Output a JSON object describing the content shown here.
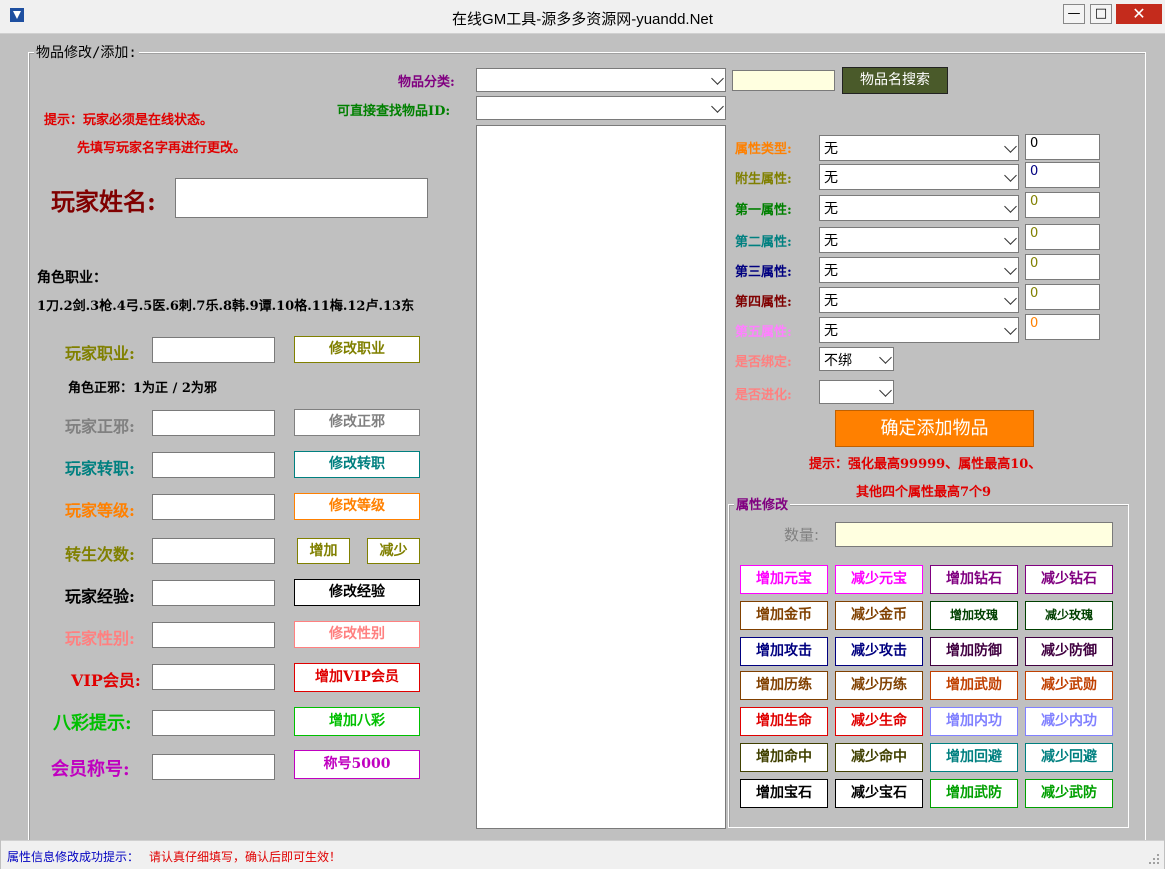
{
  "window": {
    "title": "在线GM工具-源多多资源网-yuandd.Net"
  },
  "group_main": {
    "title": "物品修改/添加:"
  },
  "tips": {
    "line1": "提示：玩家必须是在线状态。",
    "line2": "先填写玩家名字再进行更改。"
  },
  "player_name": {
    "label": "玩家姓名:",
    "value": ""
  },
  "job_info": {
    "title": "角色职业：",
    "list": "1刀.2剑.3枪.4弓.5医.6刺.7乐.8韩.9谭.10格.11梅.12卢.13东"
  },
  "zhengxie_info": "角色正邪：1为正 / 2为邪",
  "rows": [
    {
      "label": "玩家职业:",
      "value": "",
      "button": "修改职业",
      "color": "#808000"
    },
    {
      "label": "玩家正邪:",
      "value": "",
      "button": "修改正邪",
      "color": "#808080"
    },
    {
      "label": "玩家转职:",
      "value": "",
      "button": "修改转职",
      "color": "#008080"
    },
    {
      "label": "玩家等级:",
      "value": "",
      "button": "修改等级",
      "color": "#ff8000"
    },
    {
      "label": "转生次数:",
      "value": "",
      "button_add": "增加",
      "button_sub": "减少",
      "color": "#808000"
    },
    {
      "label": "玩家经验:",
      "value": "",
      "button": "修改经验",
      "color": "#000000"
    },
    {
      "label": "玩家性别:",
      "value": "",
      "button": "修改性别",
      "color": "#ff8080"
    },
    {
      "label": "VIP会员:",
      "value": "",
      "button": "增加VIP会员",
      "color": "#e00000"
    },
    {
      "label": "八彩提示:",
      "value": "",
      "button": "增加八彩",
      "color": "#00c000"
    },
    {
      "label": "会员称号:",
      "value": "",
      "button": "称号5000",
      "color": "#c000c0"
    }
  ],
  "item": {
    "category_label": "物品分类:",
    "category_value": "",
    "find_id_label": "可直接查找物品ID:",
    "find_id_value": "",
    "search_input": "",
    "search_button": "物品名搜索",
    "list_items": []
  },
  "attributes": [
    {
      "label": "属性类型:",
      "select": "无",
      "value": "0",
      "label_color": "#ff8000",
      "value_color": "#000000"
    },
    {
      "label": "附生属性:",
      "select": "无",
      "value": "0",
      "label_color": "#808000",
      "value_color": "#000080"
    },
    {
      "label": "第一属性:",
      "select": "无",
      "value": "0",
      "label_color": "#008000",
      "value_color": "#808000"
    },
    {
      "label": "第二属性:",
      "select": "无",
      "value": "0",
      "label_color": "#008080",
      "value_color": "#808000"
    },
    {
      "label": "第三属性:",
      "select": "无",
      "value": "0",
      "label_color": "#000080",
      "value_color": "#808000"
    },
    {
      "label": "第四属性:",
      "select": "无",
      "value": "0",
      "label_color": "#800000",
      "value_color": "#808000"
    },
    {
      "label": "第五属性:",
      "select": "无",
      "value": "0",
      "label_color": "#ff80ff",
      "value_color": "#ff8000"
    }
  ],
  "bind": {
    "label": "是否绑定:",
    "value": "不绑",
    "color": "#ff8080"
  },
  "evolve": {
    "label": "是否进化:",
    "value": "",
    "color": "#ff8080"
  },
  "add_item_button": "确定添加物品",
  "add_tips": {
    "line1": "提示：强化最高99999、属性最高10、",
    "line2": "其他四个属性最高7个9"
  },
  "modify": {
    "title": "属性修改",
    "quantity_label": "数量:",
    "quantity_value": "",
    "buttons": [
      {
        "label": "增加元宝",
        "color": "#ff00ff"
      },
      {
        "label": "减少元宝",
        "color": "#ff00ff"
      },
      {
        "label": "增加钻石",
        "color": "#800080"
      },
      {
        "label": "减少钻石",
        "color": "#800080"
      },
      {
        "label": "增加金币",
        "color": "#804000"
      },
      {
        "label": "减少金币",
        "color": "#804000"
      },
      {
        "label": "增加玫瑰",
        "color": "#004000"
      },
      {
        "label": "减少玫瑰",
        "color": "#004000"
      },
      {
        "label": "增加攻击",
        "color": "#000080"
      },
      {
        "label": "减少攻击",
        "color": "#000080"
      },
      {
        "label": "增加防御",
        "color": "#400040"
      },
      {
        "label": "减少防御",
        "color": "#400040"
      },
      {
        "label": "增加历练",
        "color": "#804000"
      },
      {
        "label": "减少历练",
        "color": "#804000"
      },
      {
        "label": "增加武勋",
        "color": "#c04000"
      },
      {
        "label": "减少武勋",
        "color": "#c04000"
      },
      {
        "label": "增加生命",
        "color": "#e00000"
      },
      {
        "label": "减少生命",
        "color": "#e00000"
      },
      {
        "label": "增加内功",
        "color": "#8080ff"
      },
      {
        "label": "减少内功",
        "color": "#8080ff"
      },
      {
        "label": "增加命中",
        "color": "#404000"
      },
      {
        "label": "减少命中",
        "color": "#404000"
      },
      {
        "label": "增加回避",
        "color": "#008080"
      },
      {
        "label": "减少回避",
        "color": "#008080"
      },
      {
        "label": "增加宝石",
        "color": "#000000"
      },
      {
        "label": "减少宝石",
        "color": "#000000"
      },
      {
        "label": "增加武防",
        "color": "#00a000"
      },
      {
        "label": "减少武防",
        "color": "#00a000"
      }
    ]
  },
  "status": {
    "label": "属性信息修改成功提示：",
    "message": "请认真仔细填写，确认后即可生效！"
  },
  "colors": {
    "background": "#c0c0c0",
    "add_button_bg": "#ff8000",
    "tip_red": "#e00000",
    "search_button_bg": "#4a5a2a",
    "search_input_bg": "#ffffe0",
    "quantity_bg": "#ffffe0"
  }
}
